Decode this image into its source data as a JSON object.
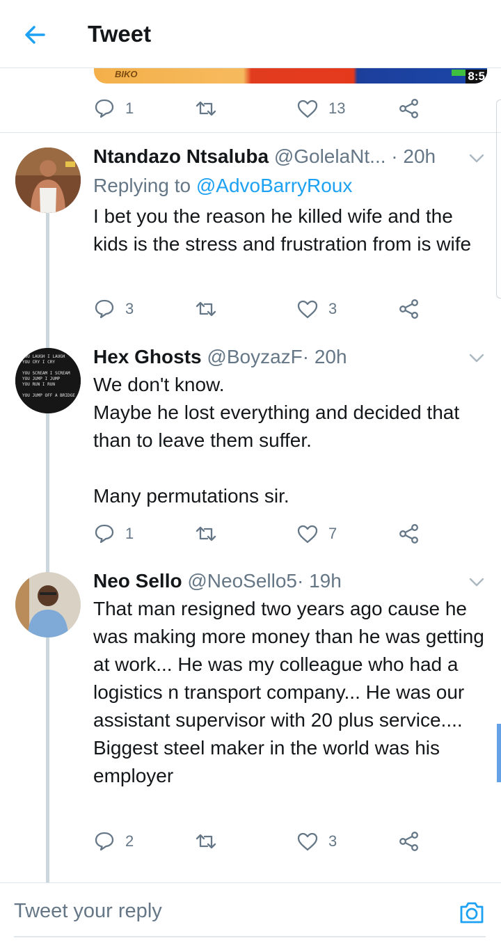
{
  "header": {
    "title": "Tweet"
  },
  "media": {
    "label": "BIKO",
    "time_badge": "8:5"
  },
  "top_actions": {
    "replies": "1",
    "retweets": "",
    "likes": "13"
  },
  "tweets": [
    {
      "name": "Ntandazo Ntsaluba",
      "handle": "@GolelaNt...",
      "time": "· 20h",
      "replying_prefix": "Replying to",
      "replying_to": "@AdvoBarryRoux",
      "text": "I bet you the reason he killed wife and the kids is the stress and frustration from is wife",
      "replies": "3",
      "retweets": "",
      "likes": "3"
    },
    {
      "name": "Hex Ghosts",
      "handle": "@BoyzazF",
      "time": "· 20h",
      "text": "We don't know.\nMaybe he lost everything and decided that than to leave them suffer.\n\nMany permutations sir.",
      "replies": "1",
      "retweets": "",
      "likes": "7",
      "avatar_text": [
        "YOU LAUGH I LAUGH",
        "YOU CRY I CRY",
        "YOU SCREAM I SCREAM",
        "YOU JUMP I JUMP",
        "YOU RUN I RUN",
        "YOU JUMP OFF A BRIDGE"
      ]
    },
    {
      "name": "Neo Sello",
      "handle": "@NeoSello5",
      "time": "· 19h",
      "text": "That man resigned two years ago cause he was making more money than he was getting at work... He was my colleague who had a logistics n transport company... He was our assistant supervisor with 20 plus service.... Biggest steel maker in the world was his employer",
      "replies": "2",
      "retweets": "",
      "likes": "3"
    }
  ],
  "reply_bar": {
    "placeholder": "Tweet your reply"
  },
  "colors": {
    "accent": "#1da1f2",
    "secondary_text": "#657786",
    "divider": "#e1e8ed"
  },
  "icons": [
    "back-arrow-icon",
    "reply-icon",
    "retweet-icon",
    "like-icon",
    "share-icon",
    "chevron-down-icon",
    "camera-icon"
  ]
}
